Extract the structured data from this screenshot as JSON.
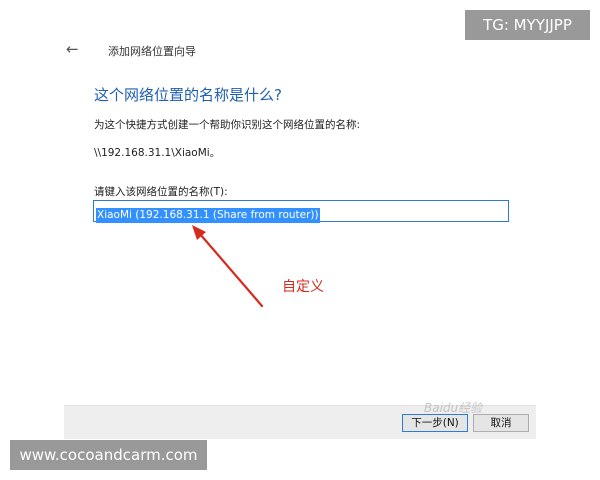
{
  "wizard": {
    "back_icon": "arrow-left-icon",
    "window_title": "添加网络位置向导",
    "heading": "这个网络位置的名称是什么?",
    "description": "为这个快捷方式创建一个帮助你识别这个网络位置的名称:",
    "network_path": "\\\\192.168.31.1\\XiaoMi。",
    "name_label": "请键入该网络位置的名称(T):",
    "name_value": "XiaoMi (192.168.31.1 (Share from router))",
    "next_button": "下一步(N)",
    "cancel_button": "取消"
  },
  "annotation": {
    "text": "自定义",
    "color": "#d52b1e"
  },
  "overlays": {
    "tg_badge": "TG: MYYJJPP",
    "site_badge": "www.cocoandcarm.com",
    "baidu_watermark": "Baidu经验"
  },
  "colors": {
    "heading": "#1f5fb0",
    "selection": "#3390ff",
    "input_border": "#2e7bd6"
  }
}
